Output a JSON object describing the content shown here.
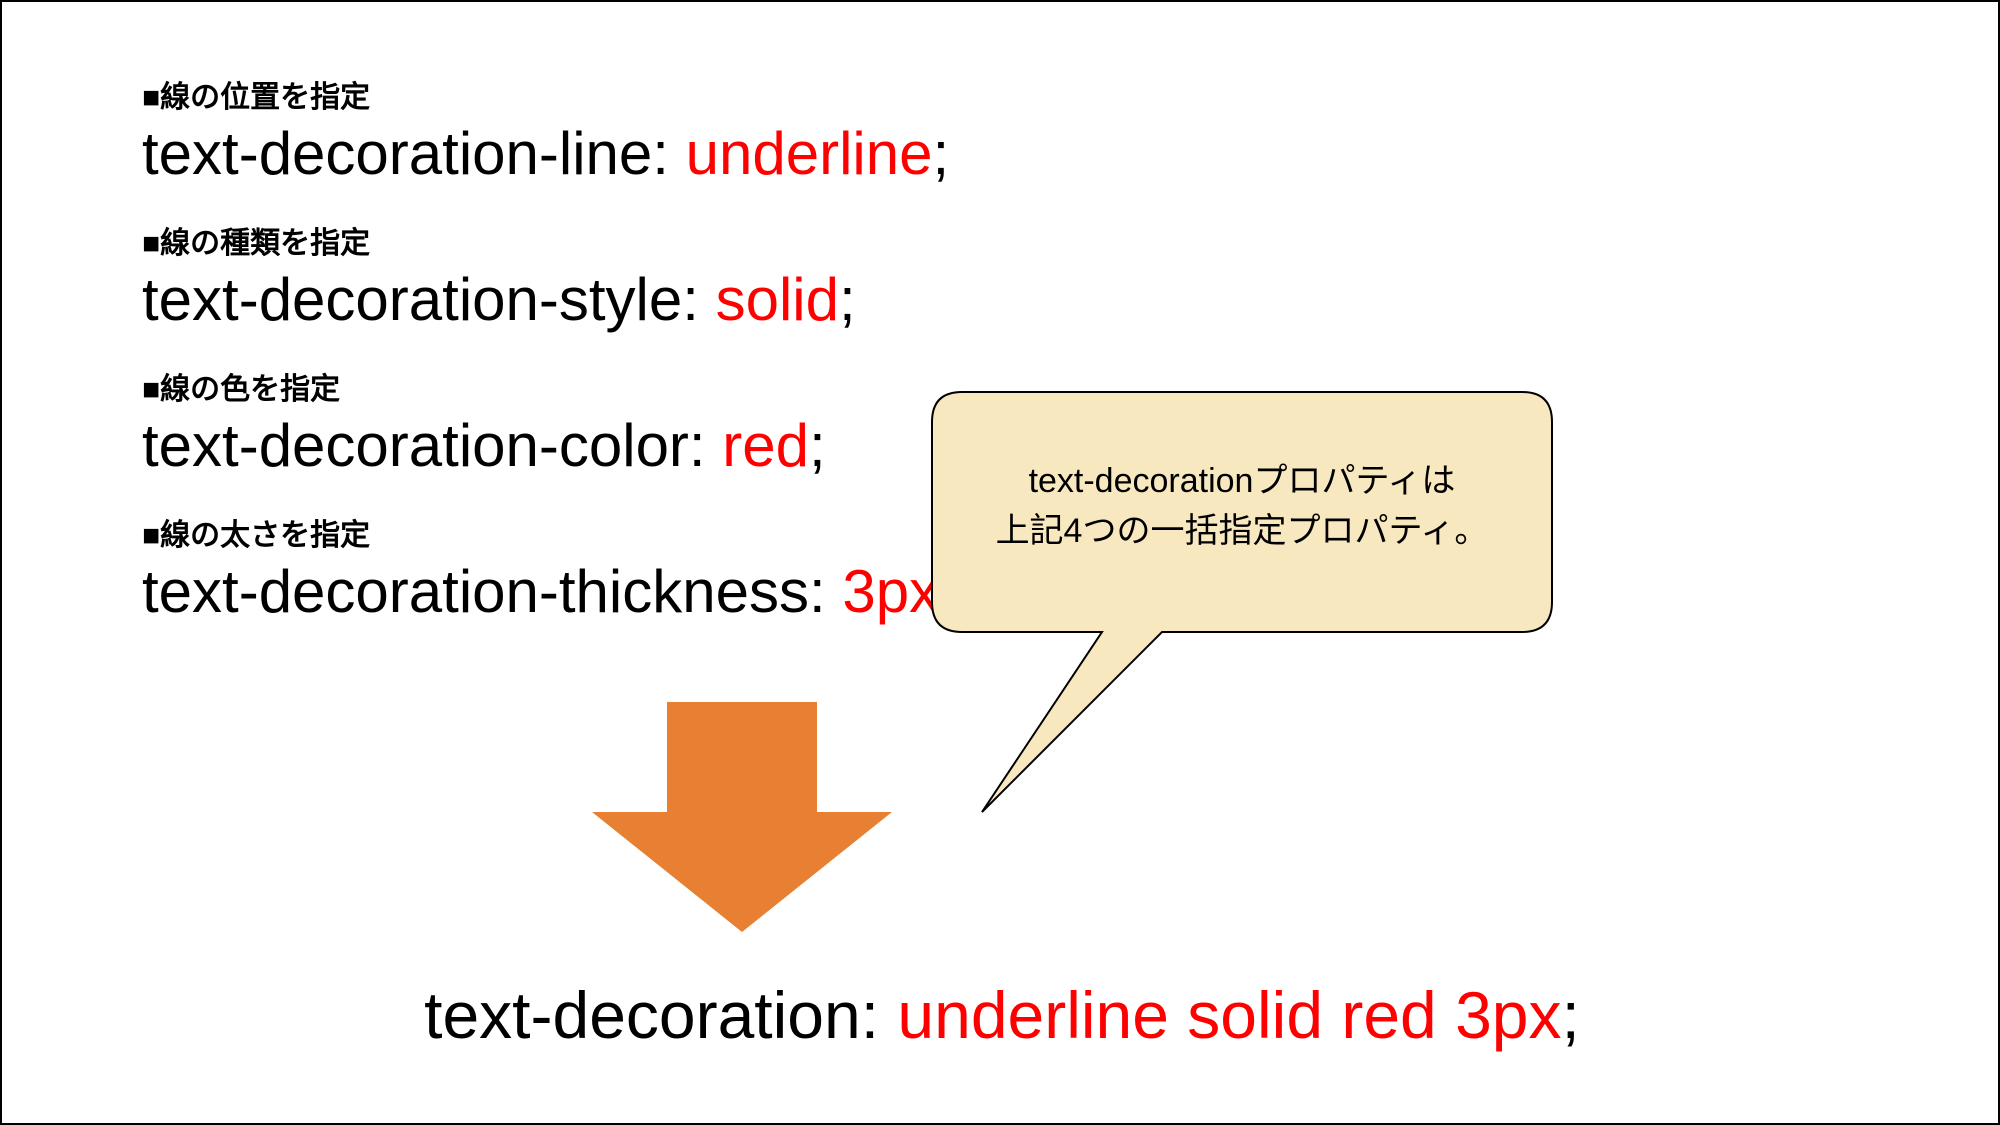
{
  "properties": [
    {
      "label": "■線の位置を指定",
      "prop": "text-decoration-line",
      "value": "underline"
    },
    {
      "label": "■線の種類を指定",
      "prop": "text-decoration-style",
      "value": "solid"
    },
    {
      "label": "■線の色を指定",
      "prop": "text-decoration-color",
      "value": "red"
    },
    {
      "label": "■線の太さを指定",
      "prop": "text-decoration-thickness",
      "value": "3px"
    }
  ],
  "callout": {
    "line1": "text-decorationプロパティは",
    "line2": "上記4つの一括指定プロパティ。"
  },
  "shorthand": {
    "prop": "text-decoration",
    "value": "underline solid red 3px"
  },
  "colors": {
    "arrow": "#e78033",
    "callout_fill": "#f8e8bf",
    "value": "#ff0000"
  }
}
